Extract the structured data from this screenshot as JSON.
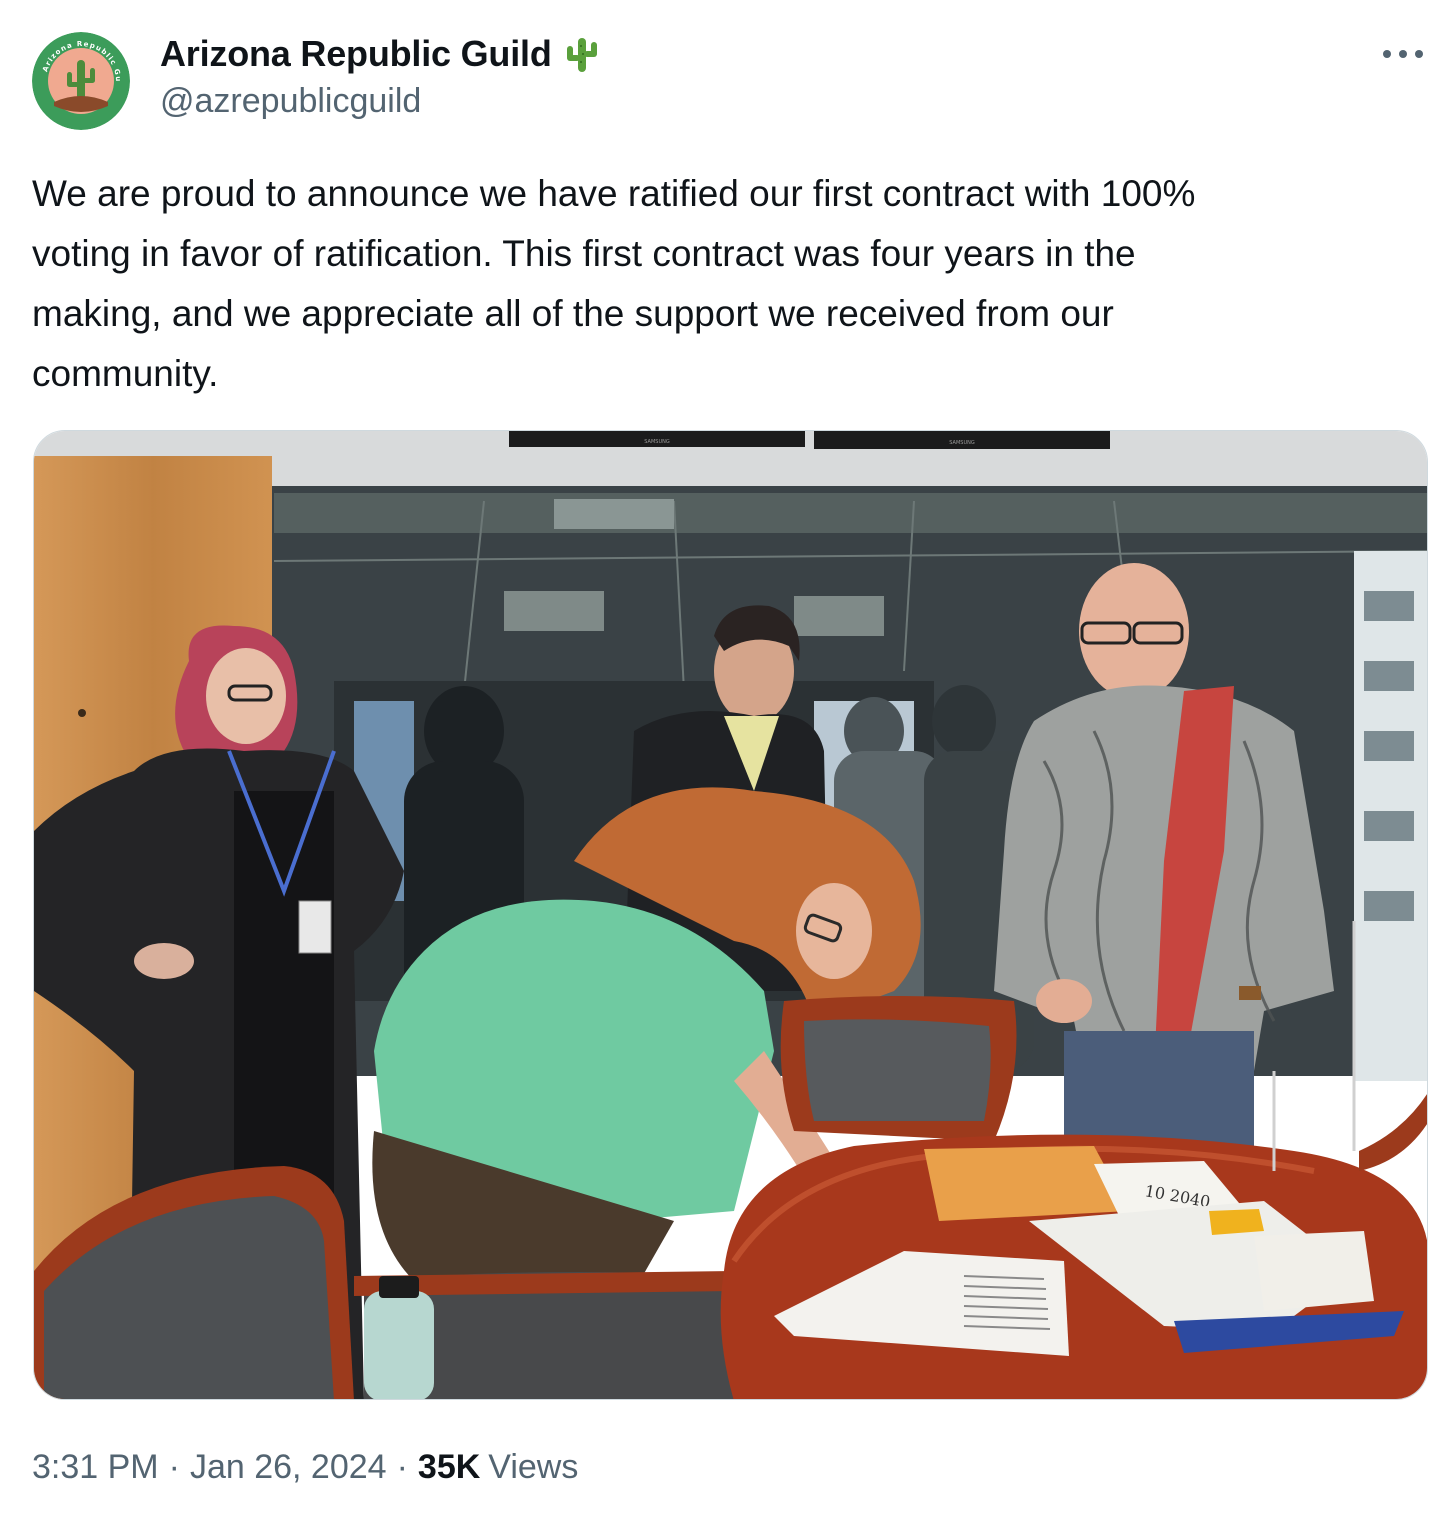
{
  "tweet": {
    "author": {
      "display_name": "Arizona Republic Guild",
      "name_emoji": "🌵",
      "handle": "@azrepublicguild",
      "avatar_ring_text": "Arizona Republic Guild",
      "avatar_colors": {
        "ring": "#3c9c5a",
        "inner": "#f0a990",
        "cactus": "#4c8c3c"
      }
    },
    "text_lines": [
      "We are proud to announce we have ratified our first contract with 100%",
      "voting in favor of ratification. This first contract was four years in the",
      "making, and we appreciate all of the support we received from our",
      "community."
    ],
    "photo": {
      "tv_brand_label": "SAMSUNG",
      "note_text": "10 2040"
    },
    "meta": {
      "time": "3:31 PM",
      "separator": "·",
      "date": "Jan 26, 2024",
      "views_count": "35K",
      "views_label": "Views"
    }
  }
}
